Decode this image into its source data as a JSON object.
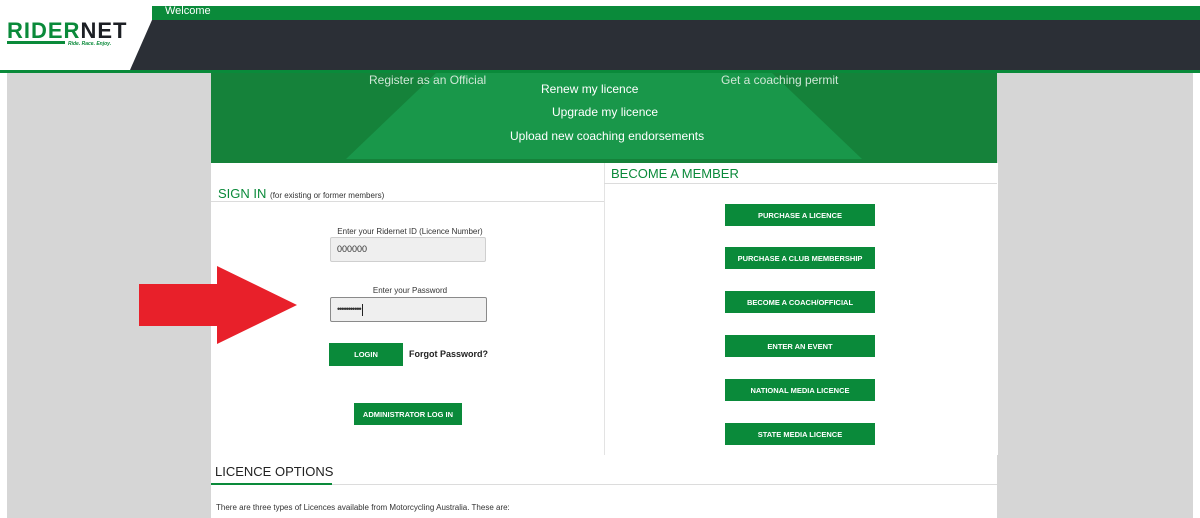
{
  "header": {
    "logo_text_a": "RIDER",
    "logo_text_b": "NET",
    "logo_tagline": "Ride. Race. Enjoy.",
    "welcome": "Welcome"
  },
  "hero": {
    "links": [
      {
        "label": "Register as an Official"
      },
      {
        "label": "Get a coaching permit"
      },
      {
        "label": "Renew my licence"
      },
      {
        "label": "Upgrade my licence"
      },
      {
        "label": "Upload new coaching endorsements"
      }
    ]
  },
  "signin": {
    "title": "SIGN IN",
    "subtitle": "(for existing or former members)",
    "id_label": "Enter your Ridernet ID (Licence Number)",
    "id_value": "000000",
    "password_label": "Enter your Password",
    "password_value": "•••••••••••",
    "login_label": "LOGIN",
    "forgot_label": "Forgot Password?",
    "admin_label": "ADMINISTRATOR LOG IN"
  },
  "member": {
    "title": "BECOME A MEMBER",
    "buttons": [
      {
        "label": "PURCHASE A LICENCE"
      },
      {
        "label": "PURCHASE A CLUB MEMBERSHIP"
      },
      {
        "label": "BECOME A COACH/OFFICIAL"
      },
      {
        "label": "ENTER AN EVENT"
      },
      {
        "label": "NATIONAL MEDIA LICENCE"
      },
      {
        "label": "STATE MEDIA LICENCE"
      }
    ]
  },
  "licence_options": {
    "title": "LICENCE OPTIONS",
    "text": "There are three types of Licences available from Motorcycling Australia. These are:"
  },
  "colors": {
    "brand_green": "#0a8a3a",
    "header_dark": "#2b2f36",
    "arrow_red": "#e8202a"
  }
}
